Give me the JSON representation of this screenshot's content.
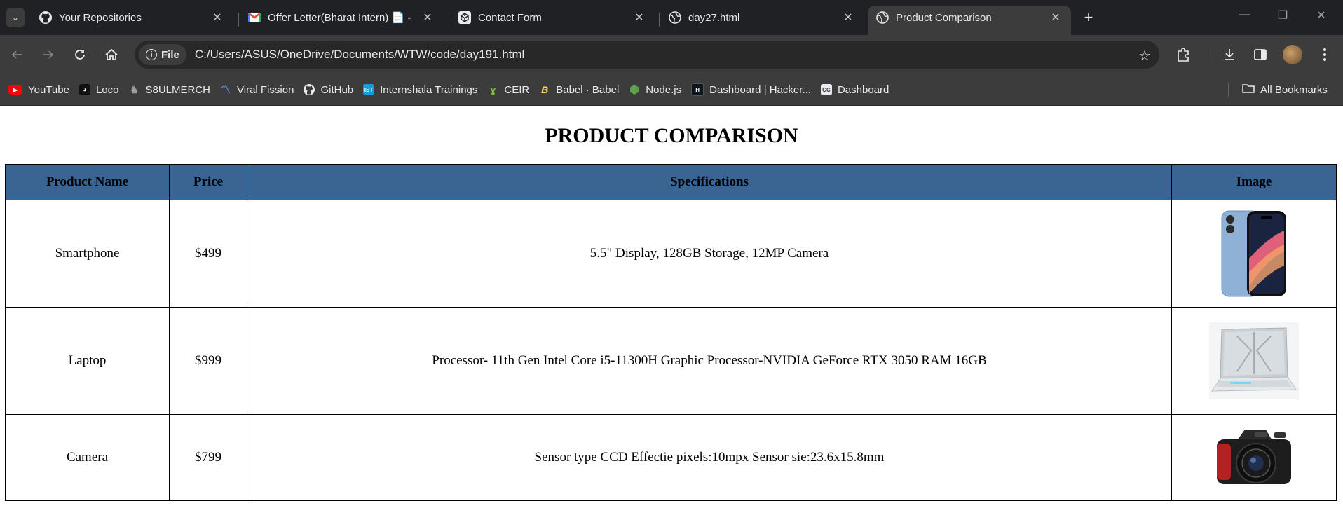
{
  "browser": {
    "tabs": [
      {
        "title": "Your Repositories",
        "icon": "github-icon"
      },
      {
        "title": "Offer Letter(Bharat Intern) 📄 - ",
        "icon": "gmail-icon"
      },
      {
        "title": "Contact Form",
        "icon": "codepen-icon"
      },
      {
        "title": "day27.html",
        "icon": "globe-icon"
      },
      {
        "title": "Product Comparison",
        "icon": "globe-icon",
        "active": true
      }
    ],
    "file_chip": "File",
    "url": "C:/Users/ASUS/OneDrive/Documents/WTW/code/day191.html",
    "bookmarks": [
      {
        "label": "YouTube"
      },
      {
        "label": "Loco"
      },
      {
        "label": "S8ULMERCH"
      },
      {
        "label": "Viral Fission"
      },
      {
        "label": "GitHub"
      },
      {
        "label": "Internshala Trainings"
      },
      {
        "label": "CEIR"
      },
      {
        "label": "Babel · Babel"
      },
      {
        "label": "Node.js"
      },
      {
        "label": "Dashboard | Hacker..."
      },
      {
        "label": "Dashboard"
      }
    ],
    "all_bookmarks": "All Bookmarks"
  },
  "page": {
    "heading": "PRODUCT COMPARISON",
    "columns": [
      "Product Name",
      "Price",
      "Specifications",
      "Image"
    ],
    "rows": [
      {
        "name": "Smartphone",
        "price": "$499",
        "specs": "5.5\" Display, 128GB Storage, 12MP Camera",
        "image": "smartphone-image"
      },
      {
        "name": "Laptop",
        "price": "$999",
        "specs": "Processor- 11th Gen Intel Core i5-11300H Graphic Processor-NVIDIA GeForce RTX 3050 RAM 16GB",
        "image": "laptop-image"
      },
      {
        "name": "Camera",
        "price": "$799",
        "specs": "Sensor type CCD Effectie pixels:10mpx Sensor sie:23.6x15.8mm",
        "image": "camera-image"
      }
    ]
  },
  "colors": {
    "header_bg": "#3a6491",
    "chrome_dark": "#202124",
    "chrome_toolbar": "#3c3c3c"
  }
}
